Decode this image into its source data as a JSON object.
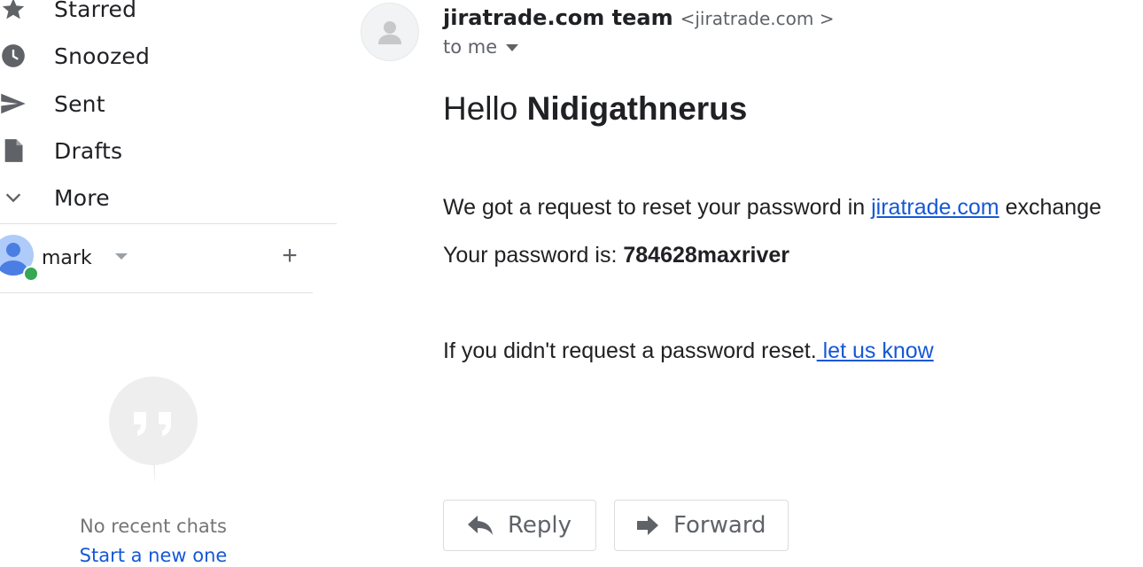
{
  "sidebar": {
    "items": [
      {
        "label": "Starred",
        "icon": "star-icon"
      },
      {
        "label": "Snoozed",
        "icon": "clock-icon"
      },
      {
        "label": "Sent",
        "icon": "send-icon"
      },
      {
        "label": "Drafts",
        "icon": "draft-icon"
      },
      {
        "label": "More",
        "icon": "chevron-down-icon"
      }
    ],
    "account": {
      "name": "mark",
      "add_label": "+"
    },
    "chat": {
      "empty_text": "No recent chats",
      "start_link": "Start a new one"
    }
  },
  "email": {
    "sender_name": "jiratrade.com team",
    "sender_email": "<jiratrade.com >",
    "to_label": "to me",
    "greeting_prefix": "Hello",
    "greeting_name": "Nidigathnerus",
    "line1_prefix": "We got a request to reset your password in",
    "line1_link": "jiratrade.com",
    "line1_suffix": "exchange",
    "line2_prefix": "Your password is:",
    "line2_password": "784628maxriver",
    "line3_prefix": "If you didn't request a password reset.",
    "line3_link": " let us know"
  },
  "actions": {
    "reply_label": "Reply",
    "forward_label": "Forward"
  },
  "colors": {
    "link": "#1558d6",
    "online": "#34a853",
    "text": "#202124",
    "muted": "#5f6368"
  }
}
